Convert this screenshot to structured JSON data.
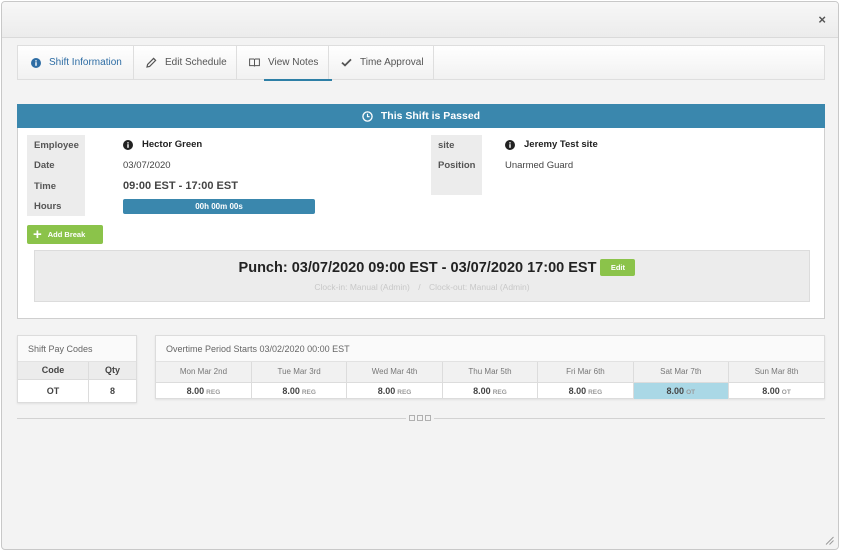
{
  "close_label": "×",
  "tabs": [
    {
      "label": "Shift Information",
      "icon": "info-circle-icon",
      "active": true
    },
    {
      "label": "Edit Schedule",
      "icon": "pencil-icon"
    },
    {
      "label": "View Notes",
      "icon": "book-icon"
    },
    {
      "label": "Time Approval",
      "icon": "check-icon"
    }
  ],
  "banner": {
    "text": "This Shift is Passed",
    "icon": "clock-icon"
  },
  "left_labels": [
    "Employee",
    "Date",
    "Time",
    "Hours"
  ],
  "employee": "Hector Green",
  "date": "03/07/2020",
  "time": "09:00 EST - 17:00 EST",
  "hours": "00h 00m 00s",
  "right_labels": [
    "site",
    "Position"
  ],
  "site": "Jeremy Test site",
  "position": "Unarmed Guard",
  "add_break_label": "Add Break",
  "punch": {
    "text": "Punch: 03/07/2020 09:00 EST - 03/07/2020 17:00 EST",
    "edit_label": "Edit",
    "clock_in": "Clock-in: Manual (Admin)",
    "separator": "/",
    "clock_out": "Clock-out: Manual (Admin)"
  },
  "pay_codes": {
    "title": "Shift Pay Codes",
    "headers": [
      "Code",
      "Qty"
    ],
    "rows": [
      [
        "OT",
        "8"
      ]
    ]
  },
  "overtime": {
    "title": "Overtime Period Starts 03/02/2020 00:00 EST",
    "days": [
      {
        "day": "Mon Mar 2nd",
        "value": "8.00",
        "kind": "REG"
      },
      {
        "day": "Tue Mar 3rd",
        "value": "8.00",
        "kind": "REG"
      },
      {
        "day": "Wed Mar 4th",
        "value": "8.00",
        "kind": "REG"
      },
      {
        "day": "Thu Mar 5th",
        "value": "8.00",
        "kind": "REG"
      },
      {
        "day": "Fri Mar 6th",
        "value": "8.00",
        "kind": "REG"
      },
      {
        "day": "Sat Mar 7th",
        "value": "8.00",
        "kind": "OT",
        "highlight": true
      },
      {
        "day": "Sun Mar 8th",
        "value": "8.00",
        "kind": "OT"
      }
    ]
  },
  "colors": {
    "accent": "#3a87ad",
    "button_green": "#8bc34a",
    "highlight": "#aad8e6"
  }
}
